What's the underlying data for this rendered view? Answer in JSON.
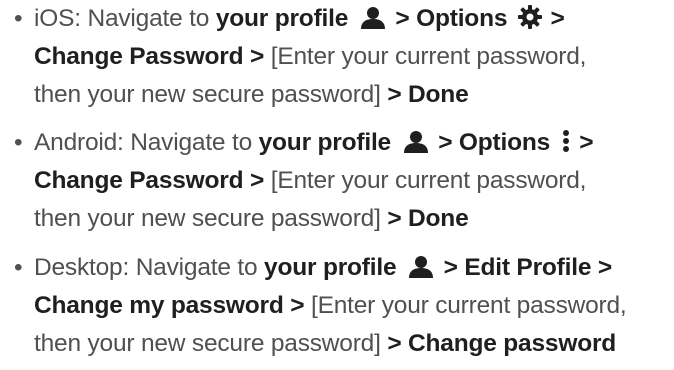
{
  "items": [
    {
      "platform": "iOS",
      "lines": [
        [
          "iOS: Navigate to ",
          "your profile",
          " > Options",
          " >"
        ],
        [
          "Change Password",
          " > ",
          "[Enter your current password,"
        ],
        [
          "then your new secure password]",
          " > Done"
        ]
      ],
      "icons": [
        "user-icon",
        "gear-icon"
      ]
    },
    {
      "platform": "Android",
      "lines": [
        [
          "Android: Navigate to ",
          "your profile",
          " > Options",
          " >"
        ],
        [
          "Change Password",
          " > ",
          "[Enter your current password,"
        ],
        [
          "then your new secure password]",
          " > Done"
        ]
      ],
      "icons": [
        "user-icon",
        "vertical-dots-icon"
      ]
    },
    {
      "platform": "Desktop",
      "lines": [
        [
          "Desktop: Navigate to ",
          "your profile",
          " > Edit Profile",
          " >"
        ],
        [
          "Change my password",
          " > ",
          "[Enter your current password,"
        ],
        [
          "then your new secure password]",
          " > Change password"
        ]
      ],
      "icons": [
        "user-icon"
      ]
    }
  ],
  "bullet": "•",
  "colors": {
    "text": "#505050",
    "bold": "#1f1f1f",
    "icon": "#1f1f1f"
  }
}
